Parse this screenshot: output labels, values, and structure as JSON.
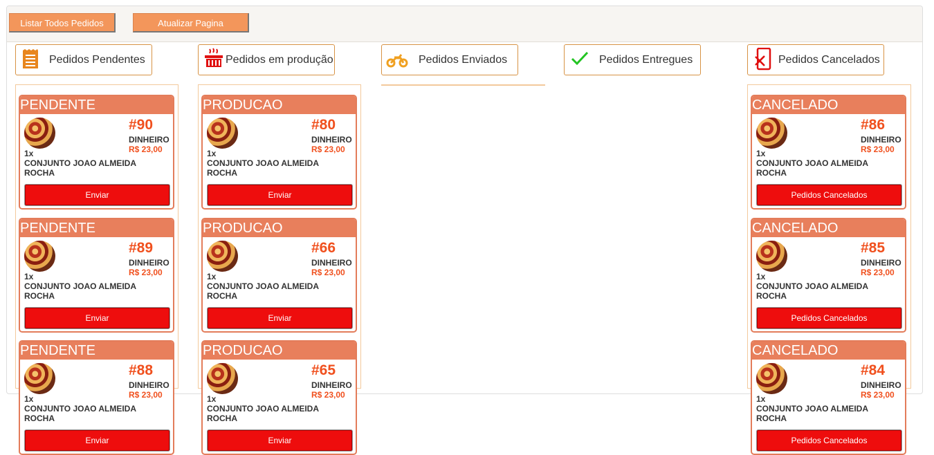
{
  "toolbar": {
    "list_all": "Listar Todos Pedidos",
    "refresh": "Atualizar Pagina"
  },
  "columns": [
    {
      "title": "Pedidos Pendentes",
      "icon": "receipt-icon"
    },
    {
      "title": "Pedidos em produção",
      "icon": "grill-icon"
    },
    {
      "title": "Pedidos Enviados",
      "icon": "motorcycle-icon"
    },
    {
      "title": "Pedidos Entregues",
      "icon": "checkmark-icon"
    },
    {
      "title": "Pedidos Cancelados",
      "icon": "phone-cancel-icon"
    }
  ],
  "pending": [
    {
      "status": "PENDENTE",
      "number": "#90",
      "payment": "DINHEIRO",
      "price": "R$ 23,00",
      "qty": "1x",
      "item": "CONJUNTO JOAO ALMEIDA ROCHA",
      "action": "Enviar"
    },
    {
      "status": "PENDENTE",
      "number": "#89",
      "payment": "DINHEIRO",
      "price": "R$ 23,00",
      "qty": "1x",
      "item": "CONJUNTO JOAO ALMEIDA ROCHA",
      "action": "Enviar"
    },
    {
      "status": "PENDENTE",
      "number": "#88",
      "payment": "DINHEIRO",
      "price": "R$ 23,00",
      "qty": "1x",
      "item": "CONJUNTO JOAO ALMEIDA ROCHA",
      "action": "Enviar"
    }
  ],
  "production": [
    {
      "status": "PRODUCAO",
      "number": "#80",
      "payment": "DINHEIRO",
      "price": "R$ 23,00",
      "qty": "1x",
      "item": "CONJUNTO JOAO ALMEIDA ROCHA",
      "action": "Enviar"
    },
    {
      "status": "PRODUCAO",
      "number": "#66",
      "payment": "DINHEIRO",
      "price": "R$ 23,00",
      "qty": "1x",
      "item": "CONJUNTO JOAO ALMEIDA ROCHA",
      "action": "Enviar"
    },
    {
      "status": "PRODUCAO",
      "number": "#65",
      "payment": "DINHEIRO",
      "price": "R$ 23,00",
      "qty": "1x",
      "item": "CONJUNTO JOAO ALMEIDA ROCHA",
      "action": "Enviar"
    }
  ],
  "cancelled": [
    {
      "status": "CANCELADO",
      "number": "#86",
      "payment": "DINHEIRO",
      "price": "R$ 23,00",
      "qty": "1x",
      "item": "CONJUNTO JOAO ALMEIDA ROCHA",
      "action": "Pedidos Cancelados"
    },
    {
      "status": "CANCELADO",
      "number": "#85",
      "payment": "DINHEIRO",
      "price": "R$ 23,00",
      "qty": "1x",
      "item": "CONJUNTO JOAO ALMEIDA ROCHA",
      "action": "Pedidos Cancelados"
    },
    {
      "status": "CANCELADO",
      "number": "#84",
      "payment": "DINHEIRO",
      "price": "R$ 23,00",
      "qty": "1x",
      "item": "CONJUNTO JOAO ALMEIDA ROCHA",
      "action": "Pedidos Cancelados"
    }
  ],
  "colors": {
    "accent": "#f3965b",
    "header": "#e87f5c",
    "number": "#f0501e",
    "button": "#ee0d0d",
    "icon": "#e8861e",
    "check": "#22c422",
    "cancel": "#e01010"
  }
}
